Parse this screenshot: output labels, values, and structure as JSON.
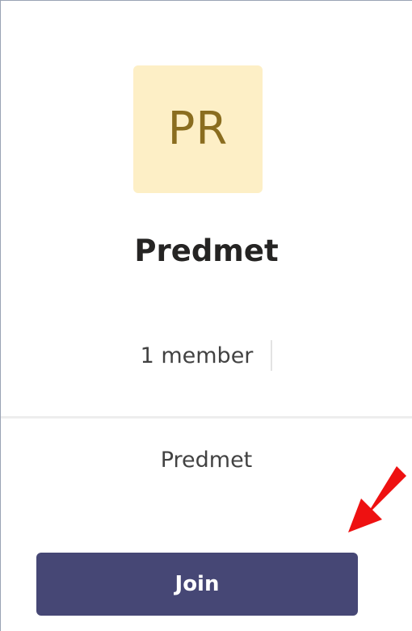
{
  "team": {
    "initials": "PR",
    "name": "Predmet",
    "members": "1 member",
    "description": "Predmet"
  },
  "actions": {
    "join_label": "Join"
  },
  "icons": {
    "annotation": "red-arrow-icon"
  },
  "colors": {
    "avatar_bg": "#fdefc6",
    "avatar_text": "#8a6d1f",
    "button_bg": "#464775",
    "arrow": "#ee1111"
  }
}
